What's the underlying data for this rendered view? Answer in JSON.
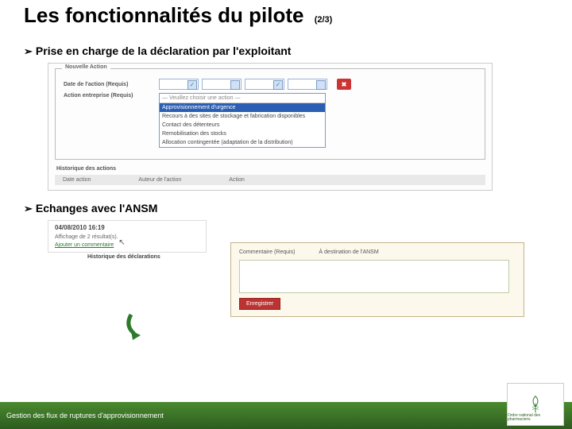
{
  "title": "Les fonctionnalités du pilote",
  "pager": "(2/3)",
  "bullets": {
    "b1": "Prise en charge de la déclaration par l'exploitant",
    "b2": "Echanges avec l'ANSM"
  },
  "panel1": {
    "legend": "Nouvelle Action",
    "dateLabel": "Date de l'action (Requis)",
    "actionLabel": "Action entreprise (Requis)",
    "stop": "✖",
    "dropdown": {
      "placeholder": "— Veuillez choisir une action —",
      "selected": "Approvisionnement d'urgence",
      "opts": [
        "Recours à des sites de stockage et fabrication disponibles",
        "Contact des détenteurs",
        "Remobilisation des stocks",
        "Allocation contingentée (adaptation de la distribution)"
      ]
    },
    "histTitle": "Historique des actions",
    "cols": {
      "c1": "Date action",
      "c2": "Auteur de l'action",
      "c3": "Action"
    }
  },
  "panel2": {
    "date": "04/08/2010 16:19",
    "count": "Affichage de 2 résultat(s).",
    "link": "Ajouter un commentaire",
    "hist": "Historique des déclarations",
    "float": {
      "h1": "Commentaire (Requis)",
      "h2": "À destination de l'ANSM",
      "btn": "Enregistrer"
    }
  },
  "footer": "Gestion des flux  de ruptures d'approvisionnement",
  "logoText": "Ordre national\ndes pharmaciens"
}
